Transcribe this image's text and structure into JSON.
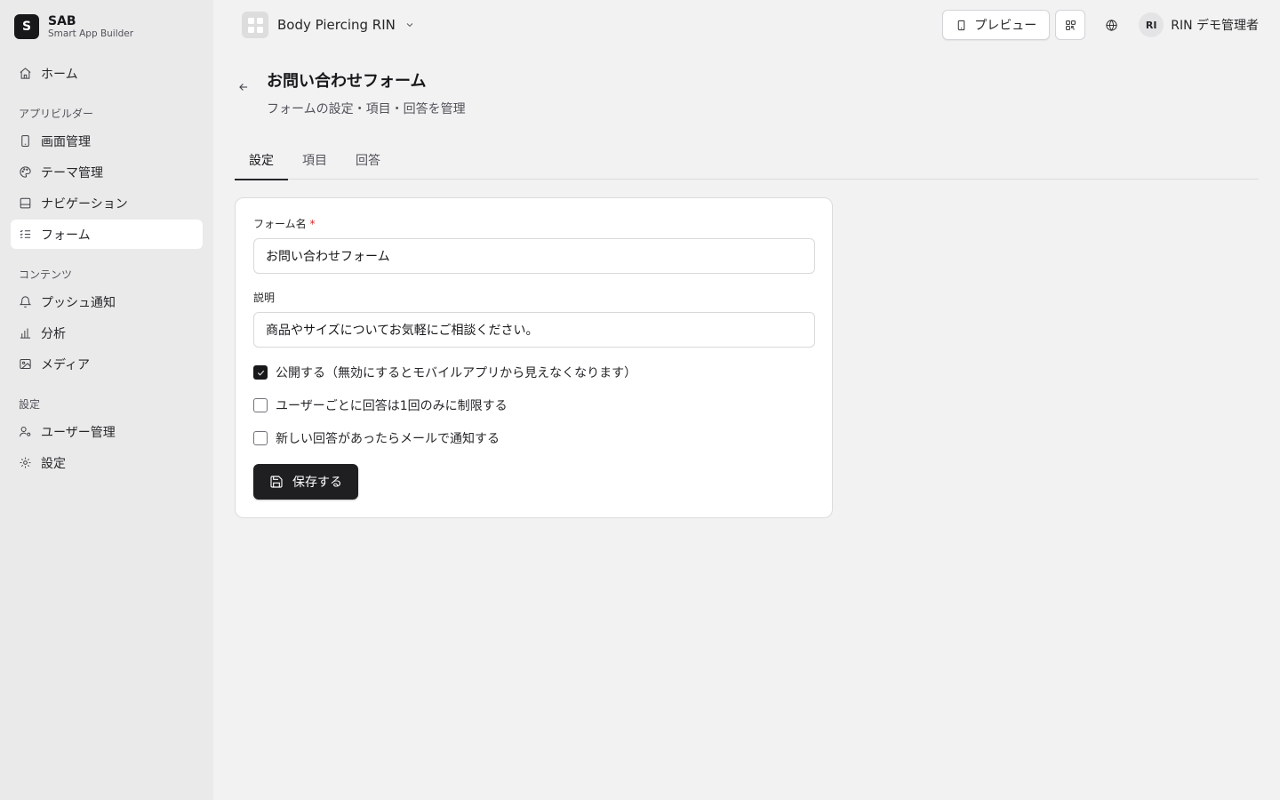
{
  "brand": {
    "initial": "S",
    "name": "SAB",
    "subtitle": "Smart App Builder"
  },
  "sidebar": {
    "home": "ホーム",
    "sections": {
      "builder": "アプリビルダー",
      "content": "コンテンツ",
      "settings": "設定"
    },
    "items": {
      "screens": "画面管理",
      "theme": "テーマ管理",
      "navigation": "ナビゲーション",
      "forms": "フォーム",
      "push": "プッシュ通知",
      "analytics": "分析",
      "media": "メディア",
      "users": "ユーザー管理",
      "settings": "設定"
    }
  },
  "topbar": {
    "app_name": "Body Piercing RIN",
    "preview_label": "プレビュー",
    "user_initials": "RI",
    "user_name": "RIN デモ管理者"
  },
  "page": {
    "title": "お問い合わせフォーム",
    "subtitle": "フォームの設定・項目・回答を管理"
  },
  "tabs": {
    "settings": "設定",
    "fields": "項目",
    "responses": "回答"
  },
  "form": {
    "name_label": "フォーム名",
    "required_mark": "*",
    "name_value": "お問い合わせフォーム",
    "desc_label": "説明",
    "desc_value": "商品やサイズについてお気軽にご相談ください。",
    "options": {
      "publish": {
        "label": "公開する（無効にするとモバイルアプリから見えなくなります）",
        "checked": true
      },
      "limit_once": {
        "label": "ユーザーごとに回答は1回のみに制限する",
        "checked": false
      },
      "email_notify": {
        "label": "新しい回答があったらメールで通知する",
        "checked": false
      }
    },
    "save_label": "保存する"
  }
}
